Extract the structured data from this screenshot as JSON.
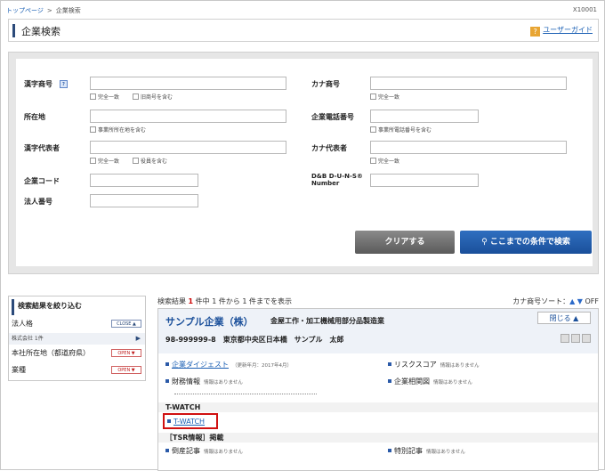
{
  "breadcrumb": {
    "home": "トップページ",
    "separator": ">",
    "current": "企業検索",
    "page_code": "X10001"
  },
  "header": {
    "title": "企業検索",
    "guide_icon": "?",
    "guide_link": "ユーザーガイド"
  },
  "search_form": {
    "kanji_name": {
      "label": "漢字商号",
      "icon": "help-icon",
      "option1": "完全一致",
      "option2": "旧商号を含む"
    },
    "kana_name": {
      "label": "カナ商号",
      "option1": "完全一致"
    },
    "address": {
      "label": "所在地",
      "option1": "事業所所在地を含む"
    },
    "phone": {
      "label": "企業電話番号",
      "option1": "事業所電話番号を含む"
    },
    "kanji_rep": {
      "label": "漢字代表者",
      "option1": "完全一致",
      "option2": "役員を含む"
    },
    "kana_rep": {
      "label": "カナ代表者",
      "option1": "完全一致"
    },
    "company_code": {
      "label": "企業コード"
    },
    "duns": {
      "label_line1": "D&B D-U-N-S®",
      "label_line2": "Number"
    },
    "corp_number": {
      "label": "法人番号"
    },
    "clear_button": "クリアする",
    "search_button": "ここまでの条件で検索"
  },
  "filter_panel": {
    "title": "検索結果を絞り込む",
    "groups": [
      {
        "label": "法人格",
        "tag": "CLOSE ▲"
      },
      {
        "label": "株式会社 1件",
        "tag": "▶"
      },
      {
        "label": "本社所在地（都道府県）",
        "tag": "OPEN ▼"
      },
      {
        "label": "業種",
        "tag": "OPEN ▼"
      }
    ]
  },
  "results": {
    "summary_prefix": "検索結果",
    "count": "1",
    "summary_suffix": "件中 1 件から 1 件までを表示",
    "sort_label": "カナ商号ソート：",
    "sort_up": "▲",
    "sort_down": "▼",
    "sort_off": "OFF"
  },
  "company": {
    "name": "サンプル企業（株）",
    "industry": "金屋工作・加工機械用部分品製造業",
    "address": "98-999999-8　東京都中央区日本橋　サンプル　太郎",
    "close_button": "閉じる ▲",
    "items": {
      "digest": {
        "label": "企業ダイジェスト",
        "note": "（更新年月：2017年4月）"
      },
      "risk": {
        "label": "リスクスコア",
        "note": "情報はありません"
      },
      "finance": {
        "label": "財務情報",
        "note": "情報はありません"
      },
      "relation": {
        "label": "企業相関図",
        "note": "情報はありません"
      }
    },
    "twatch_section": "T-WATCH",
    "twatch_link": "T-WATCH",
    "tsr_section": "［TSR情報］掲載",
    "new_article": {
      "label": "倒産記事",
      "note": "情報はありません"
    },
    "special_article": {
      "label": "特別記事",
      "note": "情報はありません"
    }
  }
}
